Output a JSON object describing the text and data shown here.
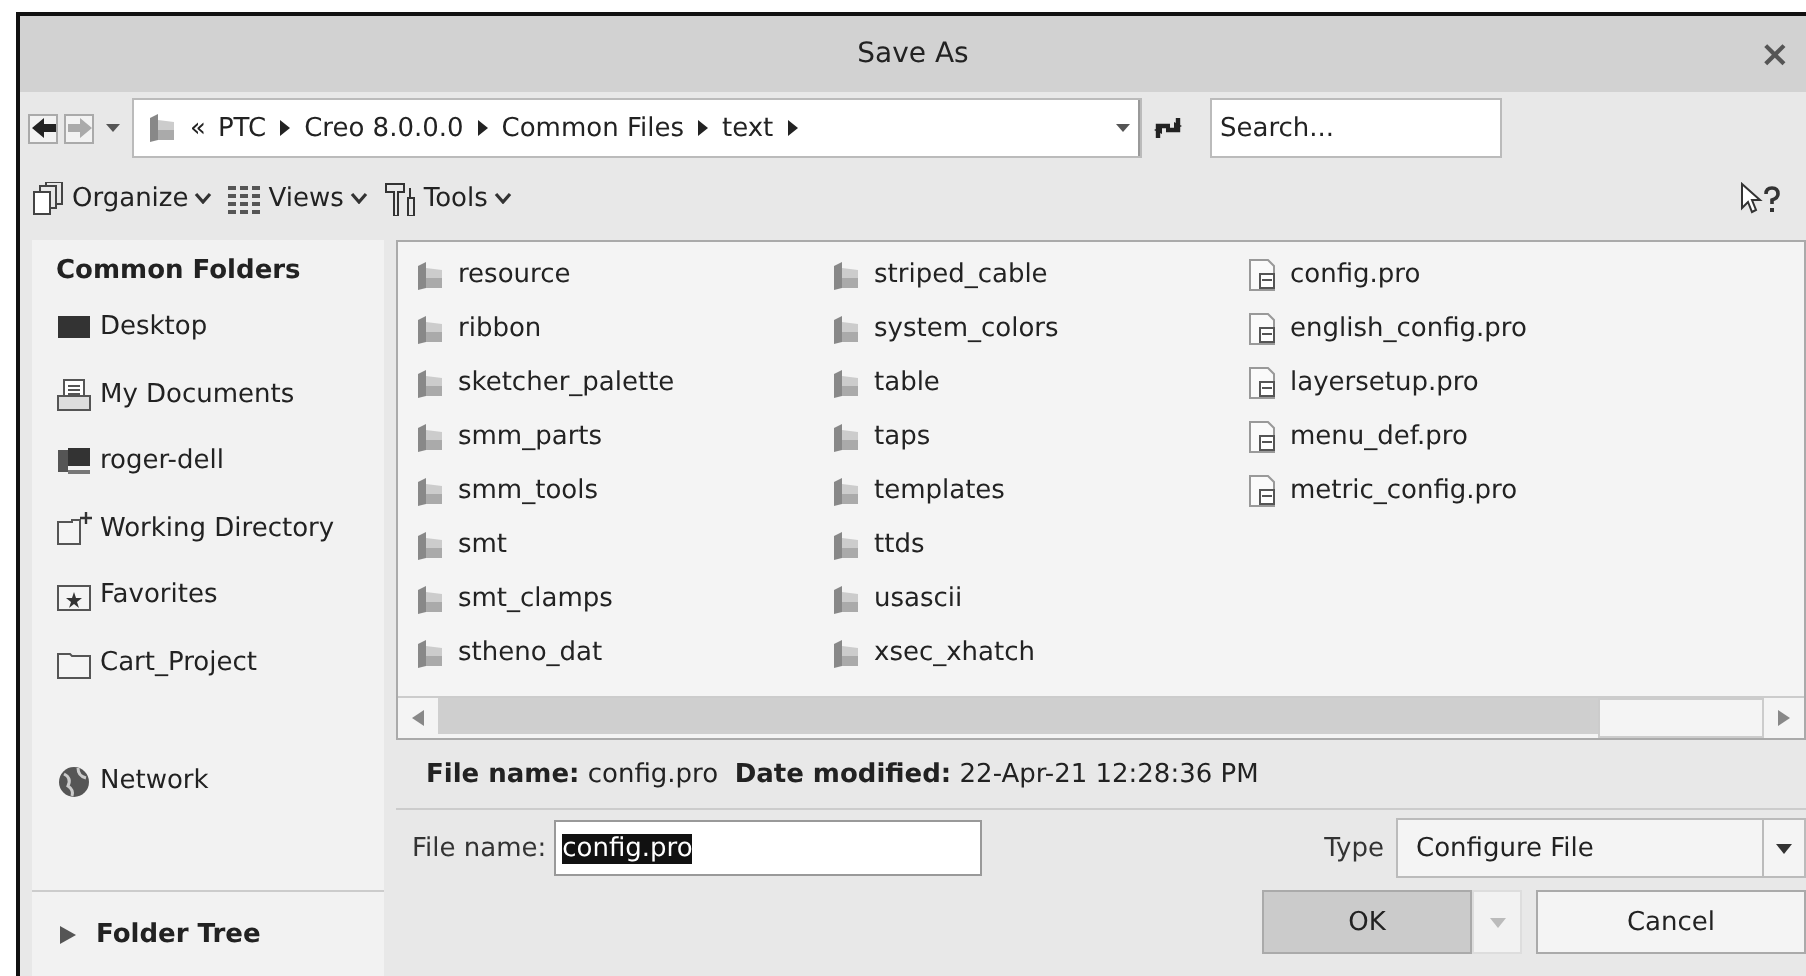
{
  "window": {
    "title": "Save As",
    "close": "×"
  },
  "address": {
    "crumbs_prefix": "«",
    "crumbs": [
      "PTC",
      "Creo 8.0.0.0",
      "Common Files",
      "text"
    ]
  },
  "search": {
    "placeholder": "Search..."
  },
  "toolbar": [
    {
      "label": "Organize",
      "kind": "organize"
    },
    {
      "label": "Views",
      "kind": "views"
    },
    {
      "label": "Tools",
      "kind": "tools"
    }
  ],
  "sidebar": {
    "heading": "Common Folders",
    "items": [
      {
        "label": "Desktop",
        "kind": "desktop"
      },
      {
        "label": "My Documents",
        "kind": "documents"
      },
      {
        "label": "roger-dell",
        "kind": "computer"
      },
      {
        "label": "Working Directory",
        "kind": "workdir"
      },
      {
        "label": "Favorites",
        "kind": "favorites"
      },
      {
        "label": "Cart_Project",
        "kind": "folder"
      }
    ],
    "network": {
      "label": "Network"
    },
    "folder_tree": {
      "label": "Folder Tree",
      "expanded": false
    }
  },
  "files": [
    {
      "name": "resource",
      "kind": "folder"
    },
    {
      "name": "ribbon",
      "kind": "folder"
    },
    {
      "name": "sketcher_palette",
      "kind": "folder"
    },
    {
      "name": "smm_parts",
      "kind": "folder"
    },
    {
      "name": "smm_tools",
      "kind": "folder"
    },
    {
      "name": "smt",
      "kind": "folder"
    },
    {
      "name": "smt_clamps",
      "kind": "folder"
    },
    {
      "name": "stheno_dat",
      "kind": "folder"
    },
    {
      "name": "striped_cable",
      "kind": "folder"
    },
    {
      "name": "system_colors",
      "kind": "folder"
    },
    {
      "name": "table",
      "kind": "folder"
    },
    {
      "name": "taps",
      "kind": "folder"
    },
    {
      "name": "templates",
      "kind": "folder"
    },
    {
      "name": "ttds",
      "kind": "folder"
    },
    {
      "name": "usascii",
      "kind": "folder"
    },
    {
      "name": "xsec_xhatch",
      "kind": "folder"
    },
    {
      "name": "config.pro",
      "kind": "file"
    },
    {
      "name": "english_config.pro",
      "kind": "file"
    },
    {
      "name": "layersetup.pro",
      "kind": "file"
    },
    {
      "name": "menu_def.pro",
      "kind": "file"
    },
    {
      "name": "metric_config.pro",
      "kind": "file"
    }
  ],
  "info": "**File name:** config.pro  **Date modified:** 22-Apr-21 12:28:36 PM",
  "file_name": {
    "label": "File name:",
    "value": "config.pro",
    "selected": true
  },
  "type": {
    "label": "Type",
    "value": "Configure File"
  },
  "buttons": [
    {
      "label": "OK",
      "kind": "default"
    },
    {
      "label": "Cancel",
      "kind": "normal"
    }
  ]
}
